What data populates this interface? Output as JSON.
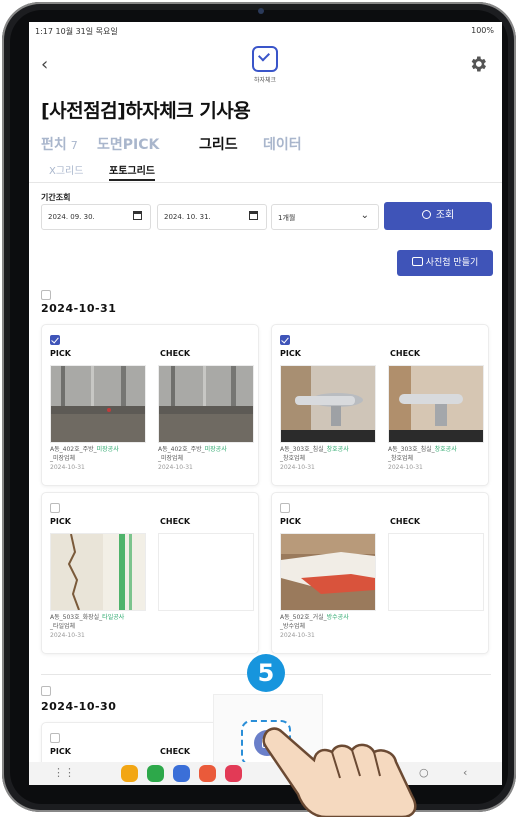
{
  "status_bar": {
    "left": "1:17  10월 31일 목요일",
    "right": "100%"
  },
  "app": {
    "logo_text": "하자체크",
    "title": "[사전점검]하자체크 기사용"
  },
  "tabs": [
    {
      "label": "펀치",
      "count": "7",
      "active": false
    },
    {
      "label": "도면PICK",
      "active": false
    },
    {
      "label": "그리드",
      "active": true
    },
    {
      "label": "데이터",
      "active": false
    }
  ],
  "subtabs": [
    {
      "label": "X그리드",
      "active": false
    },
    {
      "label": "포토그리드",
      "active": true
    }
  ],
  "filter": {
    "period_label": "기간조회",
    "start_date": "2024. 09. 30.",
    "end_date": "2024. 10. 31.",
    "range_select": "1개월",
    "search_label": "조회",
    "album_label": "사진첩 만들기"
  },
  "groups": [
    {
      "date": "2024-10-31",
      "cards": [
        {
          "checked": true,
          "pick_label": "PICK",
          "check_label": "CHECK",
          "pick": {
            "loc": "A동_402호_주방_",
            "trade": "미장공사",
            "company": "_미장업체",
            "date": "2024-10-31"
          },
          "check": {
            "loc": "A동_402호_주방_",
            "trade": "미장공사",
            "company": "_미장업체",
            "date": "2024-10-31"
          }
        },
        {
          "checked": true,
          "pick_label": "PICK",
          "check_label": "CHECK",
          "pick": {
            "loc": "A동_303호_침실_",
            "trade": "창호공사",
            "company": "_창호업체",
            "date": "2024-10-31"
          },
          "check": {
            "loc": "A동_303호_침실_",
            "trade": "창호공사",
            "company": "_창호업체",
            "date": "2024-10-31"
          }
        },
        {
          "checked": false,
          "pick_label": "PICK",
          "check_label": "CHECK",
          "pick": {
            "loc": "A동_503호_화장실_",
            "trade": "타일공사",
            "company": "_타일업체",
            "date": "2024-10-31"
          }
        },
        {
          "checked": false,
          "pick_label": "PICK",
          "check_label": "CHECK",
          "pick": {
            "loc": "A동_502호_거실_",
            "trade": "방수공사",
            "company": "_방수업체",
            "date": "2024-10-31"
          }
        }
      ]
    },
    {
      "date": "2024-10-30",
      "cards": [
        {
          "pick_label": "PICK",
          "check_label": "CHECK"
        }
      ]
    }
  ],
  "overlay": {
    "step_number": "5"
  },
  "colors": {
    "accent": "#3f54b8",
    "highlight_text": "#2aa86c",
    "step_badge": "#1795dd"
  }
}
